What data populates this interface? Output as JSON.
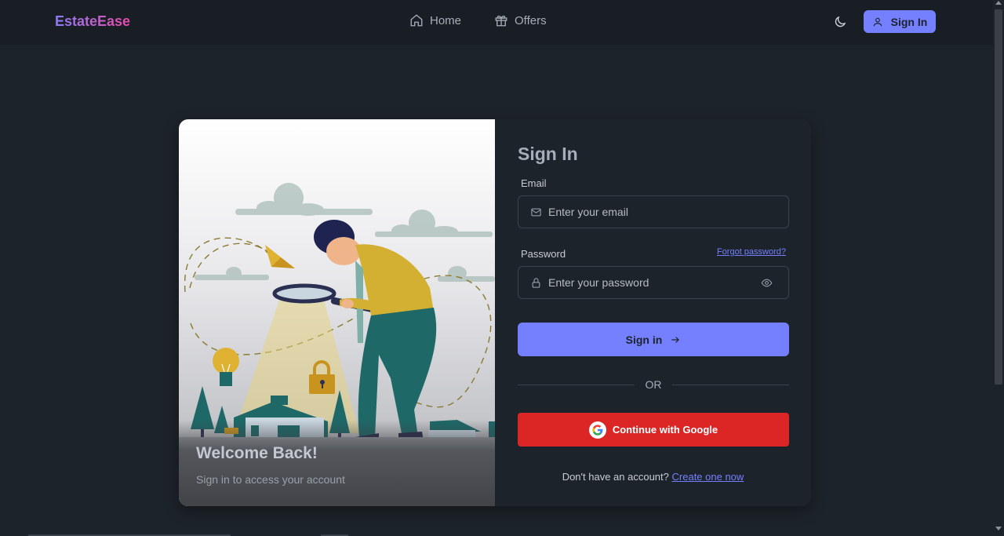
{
  "nav": {
    "brand": "EstateEase",
    "links": [
      {
        "label": "Home",
        "icon": "home-icon"
      },
      {
        "label": "Offers",
        "icon": "gift-icon"
      }
    ],
    "theme_icon": "moon-icon",
    "signin_label": "Sign In"
  },
  "hero": {
    "title": "Welcome Back!",
    "subtitle": "Sign in to access your account"
  },
  "form": {
    "title": "Sign In",
    "email_label": "Email",
    "email_placeholder": "Enter your email",
    "password_label": "Password",
    "forgot_label": "Forgot password?",
    "password_placeholder": "Enter your password",
    "submit_label": "Sign in",
    "divider_label": "OR",
    "google_label": "Continue with Google",
    "signup_prompt": "Don't have an account?",
    "signup_link": "Create one now"
  },
  "colors": {
    "primary": "#7480ff",
    "google": "#dc2626",
    "background": "#1d232a",
    "navbar": "#191e24"
  }
}
